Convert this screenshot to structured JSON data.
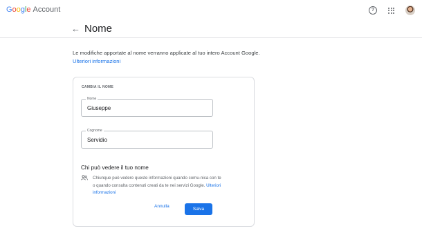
{
  "header": {
    "logo_letters": [
      "G",
      "o",
      "o",
      "g",
      "l",
      "e"
    ],
    "logo_suffix": "Account",
    "help_icon": "help-circle-icon",
    "apps_icon": "apps-grid-icon",
    "avatar": "user-avatar"
  },
  "page": {
    "back_icon": "←",
    "title": "Nome",
    "intro_text": "Le modifiche apportate al nome verranno applicate al tuo intero Account Google. ",
    "intro_link": "Ulteriori informazioni"
  },
  "form": {
    "section_label": "CAMBIA IL NOME",
    "first_name": {
      "label": "Nome",
      "value": "Giuseppe"
    },
    "last_name": {
      "label": "Cognome",
      "value": "Servidio"
    },
    "visibility_title": "Chi può vedere il tuo nome",
    "visibility_text": "Chiunque può vedere queste informazioni quando comu-nica con te o quando consulta contenuti creati da te nei servizi Google. ",
    "visibility_link": "Ulteriori informazioni",
    "cancel_label": "Annulla",
    "save_label": "Salva"
  },
  "colors": {
    "accent": "#1a73e8",
    "border": "#dadce0",
    "text_secondary": "#5f6368"
  }
}
